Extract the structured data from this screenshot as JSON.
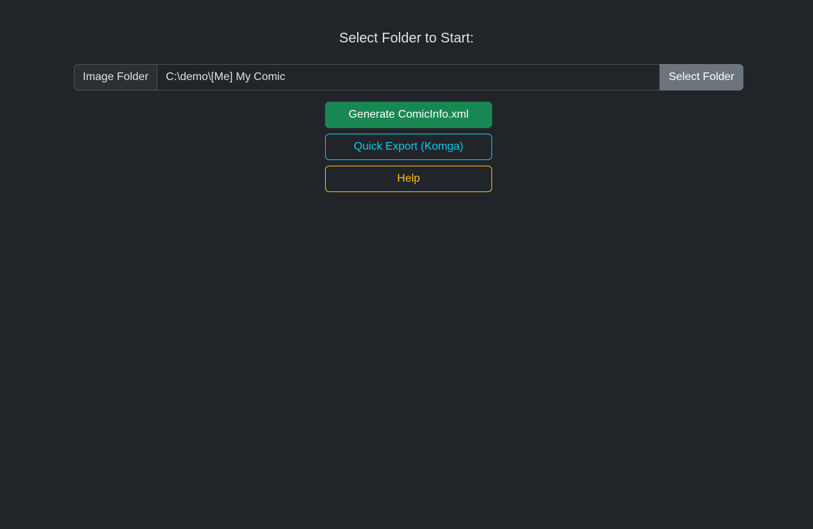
{
  "heading": "Select Folder to Start:",
  "folder_picker": {
    "label": "Image Folder",
    "value": "C:\\demo\\[Me] My Comic",
    "button_label": "Select Folder"
  },
  "actions": {
    "generate_label": "Generate ComicInfo.xml",
    "export_label": "Quick Export (Komga)",
    "help_label": "Help"
  },
  "colors": {
    "background": "#212529",
    "generate": "#198754",
    "export": "#0dcaf0",
    "help": "#ffc107",
    "secondary": "#6c757d"
  }
}
